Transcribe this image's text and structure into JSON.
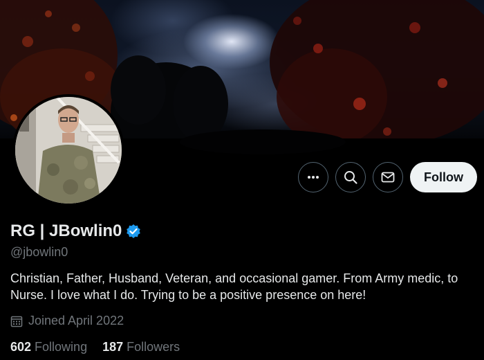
{
  "profile": {
    "display_name": "RG | JBowlin0",
    "handle": "@jbowlin0",
    "verified": true,
    "bio": "Christian, Father, Husband, Veteran, and occasional gamer. From Army medic, to Nurse. I love what I do. Trying to be a positive presence on here!",
    "joined": "Joined April 2022",
    "following_count": "602",
    "following_label": "Following",
    "followers_count": "187",
    "followers_label": "Followers"
  },
  "actions": {
    "more_icon": "more-icon",
    "search_icon": "search-icon",
    "message_icon": "envelope-icon",
    "follow_label": "Follow"
  },
  "colors": {
    "background": "#000000",
    "primary_text": "#e7e9ea",
    "secondary_text": "#71767b",
    "verified_blue": "#1d9bf0",
    "follow_button_bg": "#eff3f4"
  }
}
